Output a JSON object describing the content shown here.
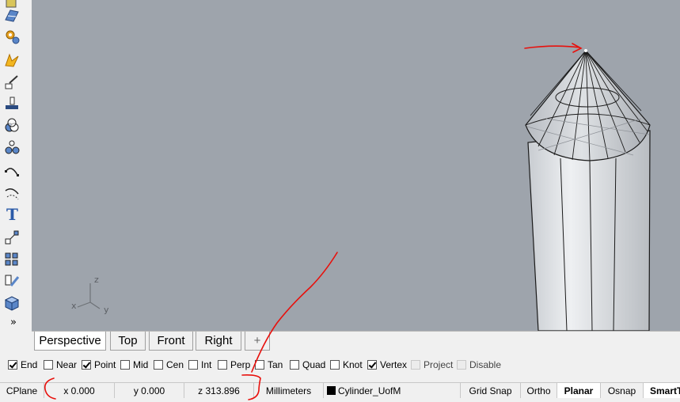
{
  "toolbar": {
    "icons": [
      "layout-icon",
      "gear-gumball-icon",
      "lightning-icon",
      "scale-icon",
      "align-icon",
      "shade-icon",
      "points-icon",
      "curve-icon",
      "curve-tools-icon",
      "text-icon",
      "transform-icon",
      "grid-array-icon",
      "edit-icon",
      "box-icon"
    ],
    "more_label": "»"
  },
  "axis": {
    "z": "z",
    "x": "x",
    "y": "y"
  },
  "tabs": [
    {
      "label": "Perspective",
      "active": true
    },
    {
      "label": "Top",
      "active": false
    },
    {
      "label": "Front",
      "active": false
    },
    {
      "label": "Right",
      "active": false
    },
    {
      "label": "+",
      "active": false
    }
  ],
  "osnap": [
    {
      "label": "End",
      "checked": true
    },
    {
      "label": "Near",
      "checked": false
    },
    {
      "label": "Point",
      "checked": true
    },
    {
      "label": "Mid",
      "checked": false
    },
    {
      "label": "Cen",
      "checked": false
    },
    {
      "label": "Int",
      "checked": false
    },
    {
      "label": "Perp",
      "checked": false
    },
    {
      "label": "Tan",
      "checked": false
    },
    {
      "label": "Quad",
      "checked": false
    },
    {
      "label": "Knot",
      "checked": false
    },
    {
      "label": "Vertex",
      "checked": true
    },
    {
      "label": "Project",
      "checked": false,
      "disabled": true
    },
    {
      "label": "Disable",
      "checked": false,
      "disabled": true
    }
  ],
  "status": {
    "cplane": "CPlane",
    "x": "x 0.000",
    "y": "y 0.000",
    "z": "z 313.896",
    "units": "Millimeters",
    "layer": "Cylinder_UofM",
    "grid_snap": "Grid Snap",
    "ortho": "Ortho",
    "planar": "Planar",
    "osnap": "Osnap",
    "smart": "SmartT"
  },
  "colors": {
    "viewport_bg": "#9ea4ac",
    "annotation": "#e8100c"
  }
}
